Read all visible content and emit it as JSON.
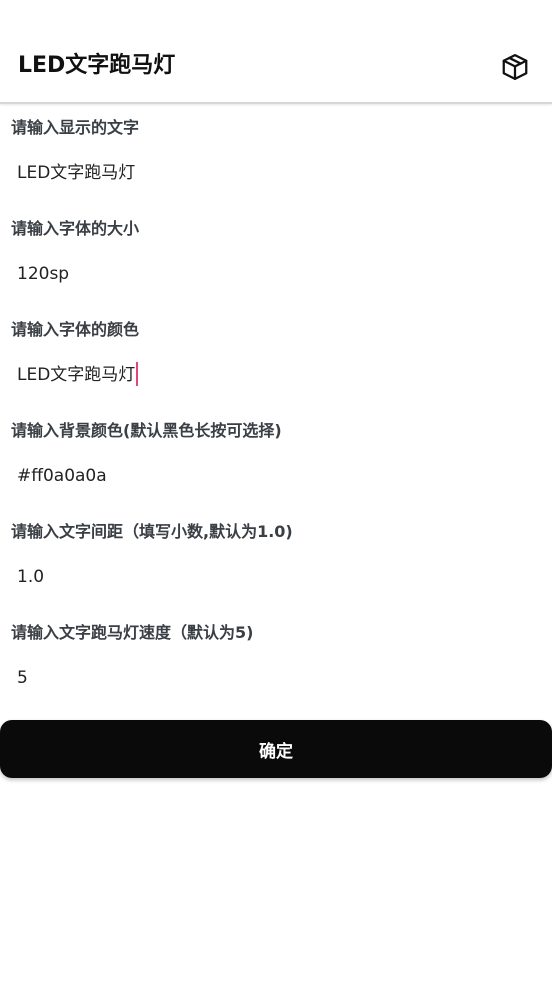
{
  "app_bar": {
    "title": "LED文字跑马灯",
    "action_icon": "cube-icon"
  },
  "form": {
    "fields": [
      {
        "label": "请输入显示的文字",
        "value": "LED文字跑马灯"
      },
      {
        "label": "请输入字体的大小",
        "value": "120sp"
      },
      {
        "label": "请输入字体的颜色",
        "value": "LED文字跑马灯",
        "focused": true
      },
      {
        "label": "请输入背景颜色(默认黑色长按可选择)",
        "value": "#ff0a0a0a"
      },
      {
        "label": "请输入文字间距（填写小数,默认为1.0)",
        "value": "1.0"
      },
      {
        "label": "请输入文字跑马灯速度（默认为5)",
        "value": "5"
      }
    ]
  },
  "confirm_button": {
    "label": "确定"
  },
  "colors": {
    "button_bg": "#0a0a0a",
    "cursor": "#e0457b",
    "label_text": "#3a3f45"
  }
}
